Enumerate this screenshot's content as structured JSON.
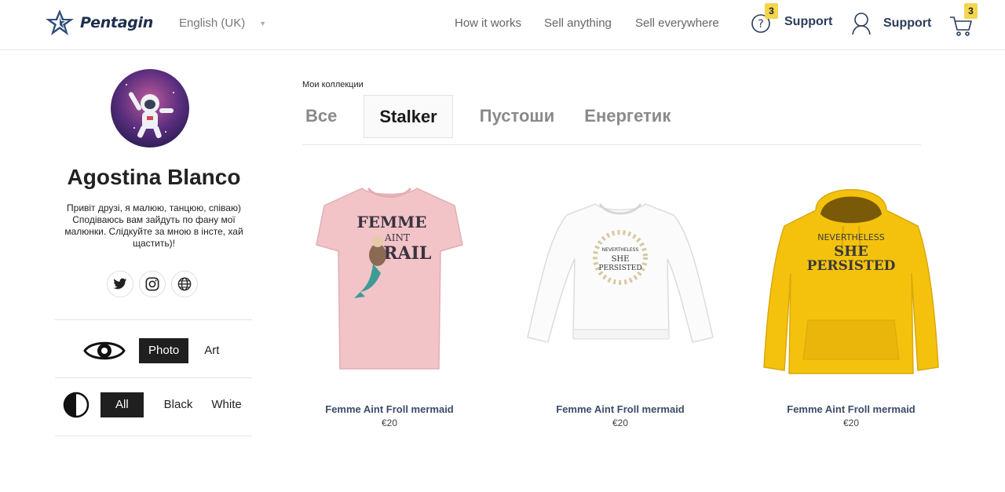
{
  "header": {
    "brand": "Pentagin",
    "language": "English (UK)",
    "nav": [
      "How it works",
      "Sell anything",
      "Sell everywhere"
    ],
    "support_help": {
      "label": "Support",
      "badge": "3"
    },
    "support_user": {
      "label": "Support"
    },
    "cart_badge": "3"
  },
  "profile": {
    "name": "Agostina Blanco",
    "bio": "Привіт друзі, я малюю, танцюю, співаю) Сподіваюсь вам зайдуть по фану мої малюнки. Слідкуйте за мною в інсте, хай щастить)!",
    "socials": [
      "twitter-icon",
      "instagram-icon",
      "globe-icon"
    ]
  },
  "filters": {
    "type": {
      "icon": "eye-icon",
      "options": [
        "Photo",
        "Art"
      ],
      "selected": "Photo"
    },
    "color": {
      "icon": "contrast-icon",
      "options": [
        "All",
        "Black",
        "White"
      ],
      "selected": "All"
    }
  },
  "collections": {
    "label": "Мои коллекции",
    "tabs": [
      "Все",
      "Stalker",
      "Пустоши",
      "Енергетик"
    ],
    "active": "Stalker"
  },
  "products": [
    {
      "title": "Femme Aint Froll mermaid",
      "price": "€20",
      "print": [
        "FEMME",
        "AINT",
        "FRAIL"
      ],
      "color": "#f2c4c8"
    },
    {
      "title": "Femme Aint Froll mermaid",
      "price": "€20",
      "print": [
        "NEVERTHELESS",
        "SHE",
        "PERSISTED"
      ],
      "color": "#ffffff"
    },
    {
      "title": "Femme Aint Froll mermaid",
      "price": "€20",
      "print": [
        "NEVERTHELESS",
        "SHE",
        "PERSISTED"
      ],
      "color": "#f4c20d"
    }
  ]
}
